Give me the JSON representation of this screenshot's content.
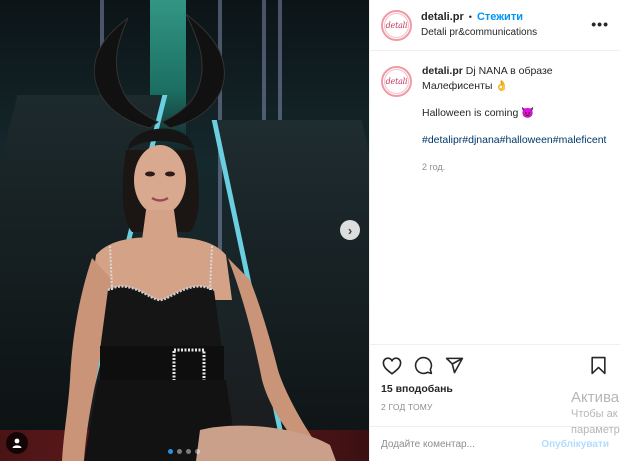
{
  "post": {
    "username": "detali.pr",
    "separator": "•",
    "follow_label": "Стежити",
    "subtitle": "Detali pr&communications",
    "avatar_text": "detali",
    "more_label": "•••"
  },
  "caption": {
    "username": "detali.pr",
    "line1": "Dj NANA в образе Малефисенты 👌",
    "line2": "Halloween is coming 😈",
    "tags": "#detalipr#djnana#halloween#maleficent",
    "age": "2 год."
  },
  "stats": {
    "likes": "15 вподобань",
    "timestamp": "2 ГОД ТОМУ"
  },
  "comment_box": {
    "placeholder": "Додайте коментар...",
    "post_label": "Опублікувати"
  },
  "overlay": {
    "line1": "Актива",
    "line2": "Чтобы ак",
    "line3": "параметр"
  },
  "carousel": {
    "slides": 4,
    "active_index": 0
  },
  "icons": [
    "next-arrow-icon",
    "user-tag-icon",
    "heart-icon",
    "comment-icon",
    "share-icon",
    "bookmark-icon",
    "more-icon"
  ],
  "colors": {
    "link": "#0095f6",
    "post_button": "#b3dbff",
    "muted": "#8e8e8e"
  }
}
